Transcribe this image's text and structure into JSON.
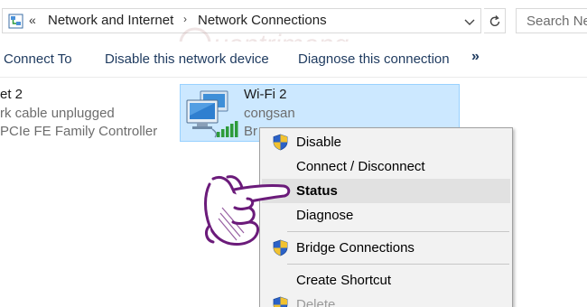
{
  "address_bar": {
    "back_chevrons": "«",
    "crumbs": [
      "Network and Internet",
      "Network Connections"
    ],
    "separator": "›"
  },
  "search": {
    "placeholder": "Search Net"
  },
  "toolbar": {
    "connect_to": "Connect To",
    "disable_device": "Disable this network device",
    "diagnose": "Diagnose this connection",
    "more": "»"
  },
  "adapters": {
    "ethernet": {
      "name": "et 2",
      "status": "rk cable unplugged",
      "device": "PCIe FE Family Controller"
    },
    "wifi": {
      "name": "Wi-Fi 2",
      "ssid": "congsan",
      "device": "Br"
    }
  },
  "watermark_text": "uantrimang",
  "context_menu": {
    "items": [
      {
        "label": "Disable",
        "shield": true
      },
      {
        "label": "Connect / Disconnect",
        "shield": false
      },
      {
        "label": "Status",
        "shield": false,
        "bold": true,
        "highlighted": true
      },
      {
        "label": "Diagnose",
        "shield": false
      },
      {
        "label": "Bridge Connections",
        "shield": true
      },
      {
        "label": "Create Shortcut",
        "shield": false
      },
      {
        "label": "Delete",
        "shield": true,
        "disabled": true
      }
    ]
  },
  "colors": {
    "selection_bg": "#cce8ff",
    "selection_border": "#99d1ff",
    "menu_bg": "#f2f2f2",
    "menu_highlight": "#e1e1e1",
    "hand_fill": "#ffffff",
    "hand_stroke": "#6b1b7a"
  }
}
